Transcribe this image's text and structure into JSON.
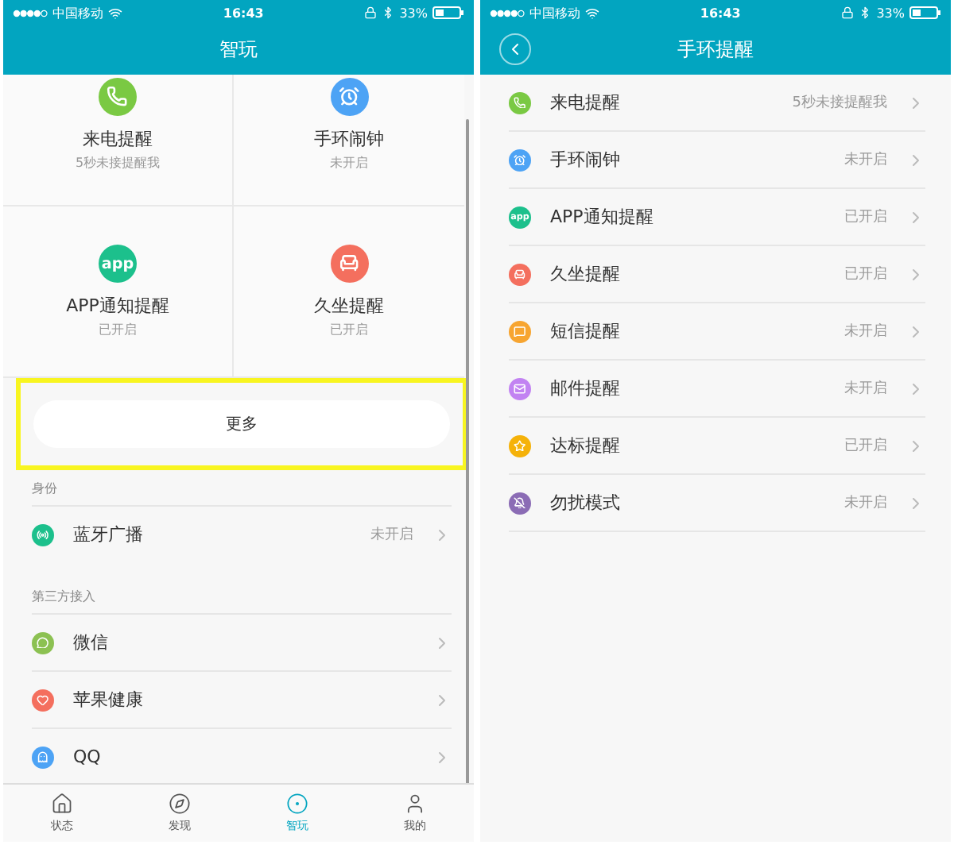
{
  "left_screen": {
    "status_bar": {
      "carrier": "中国移动",
      "time": "16:43",
      "battery": "33%"
    },
    "title": "智玩",
    "tiles": [
      {
        "label": "来电提醒",
        "status": "5秒未接提醒我",
        "color": "#7ac943"
      },
      {
        "label": "手环闹钟",
        "status": "未开启",
        "color": "#4da3f5"
      },
      {
        "label": "APP通知提醒",
        "status": "已开启",
        "color": "#1cc08c",
        "icon_text": "app"
      },
      {
        "label": "久坐提醒",
        "status": "已开启",
        "color": "#f46f5e"
      }
    ],
    "more_button": "更多",
    "sections": [
      {
        "heading": "身份",
        "rows": [
          {
            "label": "蓝牙广播",
            "value": "未开启",
            "color": "#1cc08c"
          }
        ]
      },
      {
        "heading": "第三方接入",
        "rows": [
          {
            "label": "微信",
            "color": "#8cc152"
          },
          {
            "label": "苹果健康",
            "color": "#f46f5e"
          },
          {
            "label": "QQ",
            "color": "#4da3f5"
          }
        ]
      }
    ],
    "tab_bar": [
      {
        "label": "状态",
        "selected": false
      },
      {
        "label": "发现",
        "selected": false
      },
      {
        "label": "智玩",
        "selected": true
      },
      {
        "label": "我的",
        "selected": false
      }
    ]
  },
  "right_screen": {
    "status_bar": {
      "carrier": "中国移动",
      "time": "16:43",
      "battery": "33%"
    },
    "title": "手环提醒",
    "rows": [
      {
        "label": "来电提醒",
        "value": "5秒未接提醒我",
        "color": "#7ac943"
      },
      {
        "label": "手环闹钟",
        "value": "未开启",
        "color": "#4da3f5"
      },
      {
        "label": "APP通知提醒",
        "value": "已开启",
        "color": "#1cc08c",
        "icon_text": "app"
      },
      {
        "label": "久坐提醒",
        "value": "已开启",
        "color": "#f46f5e"
      },
      {
        "label": "短信提醒",
        "value": "未开启",
        "color": "#f7a531"
      },
      {
        "label": "邮件提醒",
        "value": "未开启",
        "color": "#c283f2"
      },
      {
        "label": "达标提醒",
        "value": "已开启",
        "color": "#f5b20a"
      },
      {
        "label": "勿扰模式",
        "value": "未开启",
        "color": "#8b6cb5"
      }
    ]
  }
}
